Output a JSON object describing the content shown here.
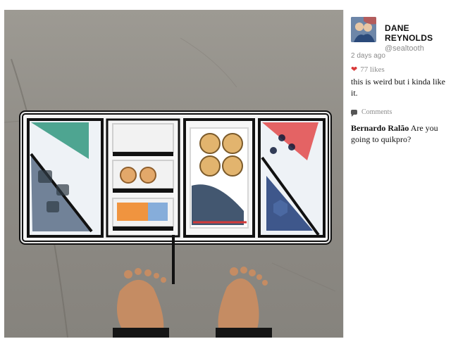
{
  "profile": {
    "display_name": "DANE REYNOLDS",
    "handle": "@sealtooth"
  },
  "post": {
    "time": "2 days ago",
    "likes": "77 likes",
    "caption": "this is weird but i kinda like it."
  },
  "comments": {
    "header": "Comments",
    "items": [
      {
        "author": "Bernardo Ralão",
        "text": "Are you going to quikpro?"
      }
    ]
  },
  "colors": {
    "accent_heart": "#d93a3a",
    "muted_text": "#8c8c8c"
  },
  "icons": {
    "heart": "heart-icon",
    "comment": "comment-bubble-icon"
  }
}
